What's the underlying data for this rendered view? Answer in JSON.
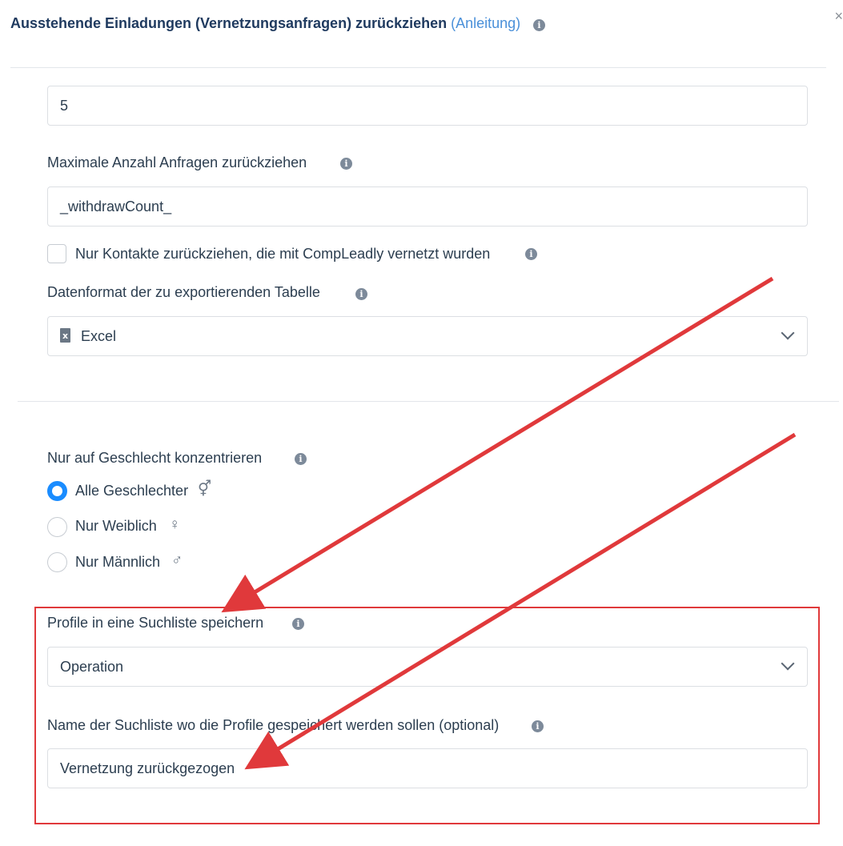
{
  "header": {
    "title": "Ausstehende Einladungen (Vernetzungsanfragen) zurückziehen",
    "guide_link": "(Anleitung)",
    "close_label": "×"
  },
  "fields": {
    "top_value": "5",
    "max_withdraw_label": "Maximale Anzahl Anfragen zurückziehen",
    "max_withdraw_value": "_withdrawCount_",
    "only_compleadly_label": "Nur Kontakte zurückziehen, die mit CompLeadly vernetzt wurden",
    "only_compleadly_checked": false,
    "export_format_label": "Datenformat der zu exportierenden Tabelle",
    "export_format_value": "Excel"
  },
  "gender": {
    "label": "Nur auf Geschlecht konzentrieren",
    "options": [
      {
        "label": "Alle Geschlechter",
        "icon": "⚥",
        "checked": true
      },
      {
        "label": "Nur Weiblich",
        "icon": "♀",
        "checked": false
      },
      {
        "label": "Nur Männlich",
        "icon": "♂",
        "checked": false
      }
    ]
  },
  "searchlist": {
    "save_label": "Profile in eine Suchliste speichern",
    "save_value": "Operation",
    "name_label": "Name der Suchliste wo die Profile gespeichert werden sollen (optional)",
    "name_value": "Vernetzung zurückgezogen"
  },
  "info_icon": "i",
  "colors": {
    "accent": "#1a8cff",
    "annotation": "#e0393b",
    "title": "#1f3a5f"
  }
}
